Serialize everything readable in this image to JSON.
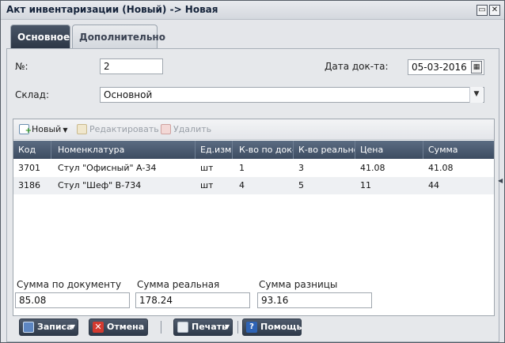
{
  "window": {
    "title": "Акт инвентаризации (Новый) -> Новая",
    "maximize_icon": "window-maximize-icon",
    "close_icon": "close-icon"
  },
  "tabs": [
    {
      "label": "Основное",
      "active": true
    },
    {
      "label": "Дополнительно",
      "active": false
    }
  ],
  "form": {
    "number_label": "№:",
    "number_value": "2",
    "date_label": "Дата док-та:",
    "date_value": "05-03-2016",
    "warehouse_label": "Склад:",
    "warehouse_value": "Основной"
  },
  "grid_toolbar": {
    "new_label": "Новый",
    "edit_label": "Редактировать",
    "delete_label": "Удалить"
  },
  "grid": {
    "columns": [
      "Код",
      "Номенклатура",
      "Ед.изм.",
      "К-во по док-м",
      "К-во реально",
      "Цена",
      "Сумма"
    ],
    "rows": [
      [
        "3701",
        "Стул \"Офисный\" А-34",
        "шт",
        "1",
        "3",
        "41.08",
        "41.08"
      ],
      [
        "3186",
        "Стул \"Шеф\" В-734",
        "шт",
        "4",
        "5",
        "11",
        "44"
      ]
    ]
  },
  "totals": {
    "doc_sum_label": "Сумма по документу",
    "doc_sum_value": "85.08",
    "real_sum_label": "Сумма реальная",
    "real_sum_value": "178.24",
    "diff_sum_label": "Сумма разницы",
    "diff_sum_value": "93.16"
  },
  "buttons": {
    "save_label": "Записать",
    "cancel_label": "Отмена",
    "print_label": "Печать",
    "help_label": "Помощь"
  }
}
